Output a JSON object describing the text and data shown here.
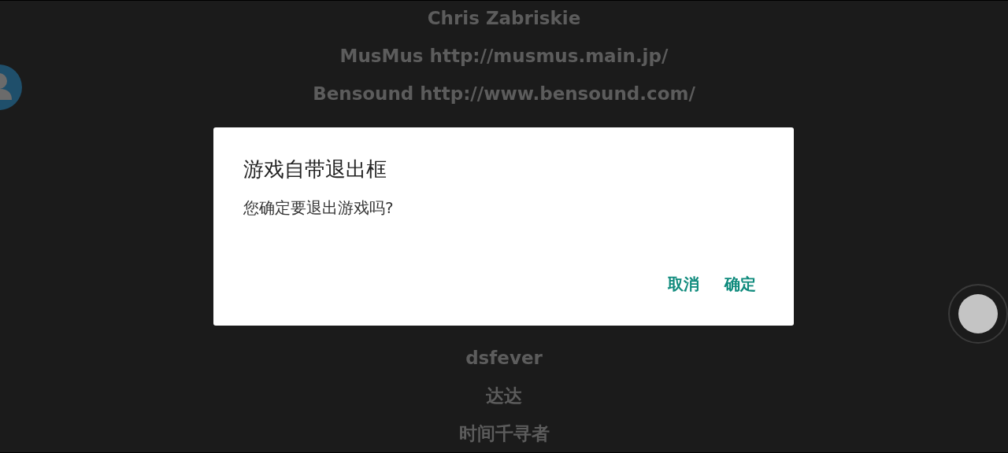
{
  "credits": [
    "Chris Zabriskie",
    "MusMus http://musmus.main.jp/",
    "Bensound http://www.bensound.com/",
    "dsfever",
    "达达",
    "时间千寻者"
  ],
  "dialog": {
    "title": "游戏自带退出框",
    "message": "您确定要退出游戏吗?",
    "buttons": [
      "取消",
      "确定"
    ]
  }
}
